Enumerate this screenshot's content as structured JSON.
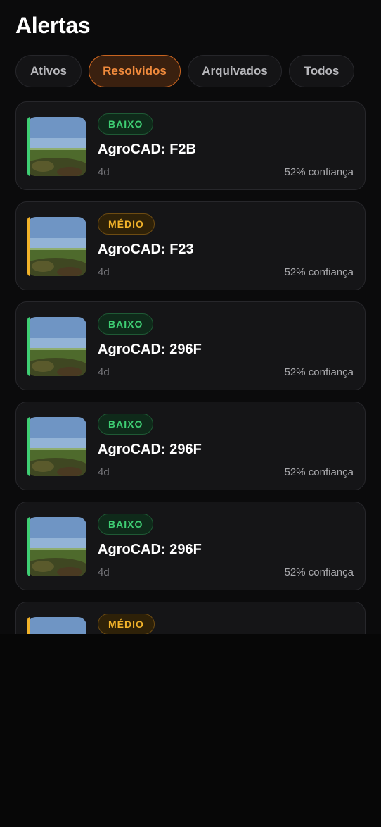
{
  "header": {
    "title": "Alertas"
  },
  "tabs": [
    {
      "label": "Ativos",
      "active": false
    },
    {
      "label": "Resolvidos",
      "active": true
    },
    {
      "label": "Arquivados",
      "active": false
    },
    {
      "label": "Todos",
      "active": false
    }
  ],
  "alerts": [
    {
      "severity": "BAIXO",
      "level": "baixo",
      "title": "AgroCAD: F2B",
      "age": "4d",
      "confidence": "52% confiança"
    },
    {
      "severity": "MÉDIO",
      "level": "medio",
      "title": "AgroCAD: F23",
      "age": "4d",
      "confidence": "52% confiança"
    },
    {
      "severity": "BAIXO",
      "level": "baixo",
      "title": "AgroCAD: 296F",
      "age": "4d",
      "confidence": "52% confiança"
    },
    {
      "severity": "BAIXO",
      "level": "baixo",
      "title": "AgroCAD: 296F",
      "age": "4d",
      "confidence": "52% confiança"
    },
    {
      "severity": "BAIXO",
      "level": "baixo",
      "title": "AgroCAD: 296F",
      "age": "4d",
      "confidence": "52% confiança"
    },
    {
      "severity": "MÉDIO",
      "level": "medio",
      "title": "",
      "age": "",
      "confidence": ""
    }
  ],
  "colors": {
    "accent_active": "#f08a3c",
    "severity_low": "#3fcf74",
    "severity_medium": "#f2b32a",
    "background": "#0b0b0c"
  },
  "icons": {
    "thumbnail": "field-photo"
  }
}
